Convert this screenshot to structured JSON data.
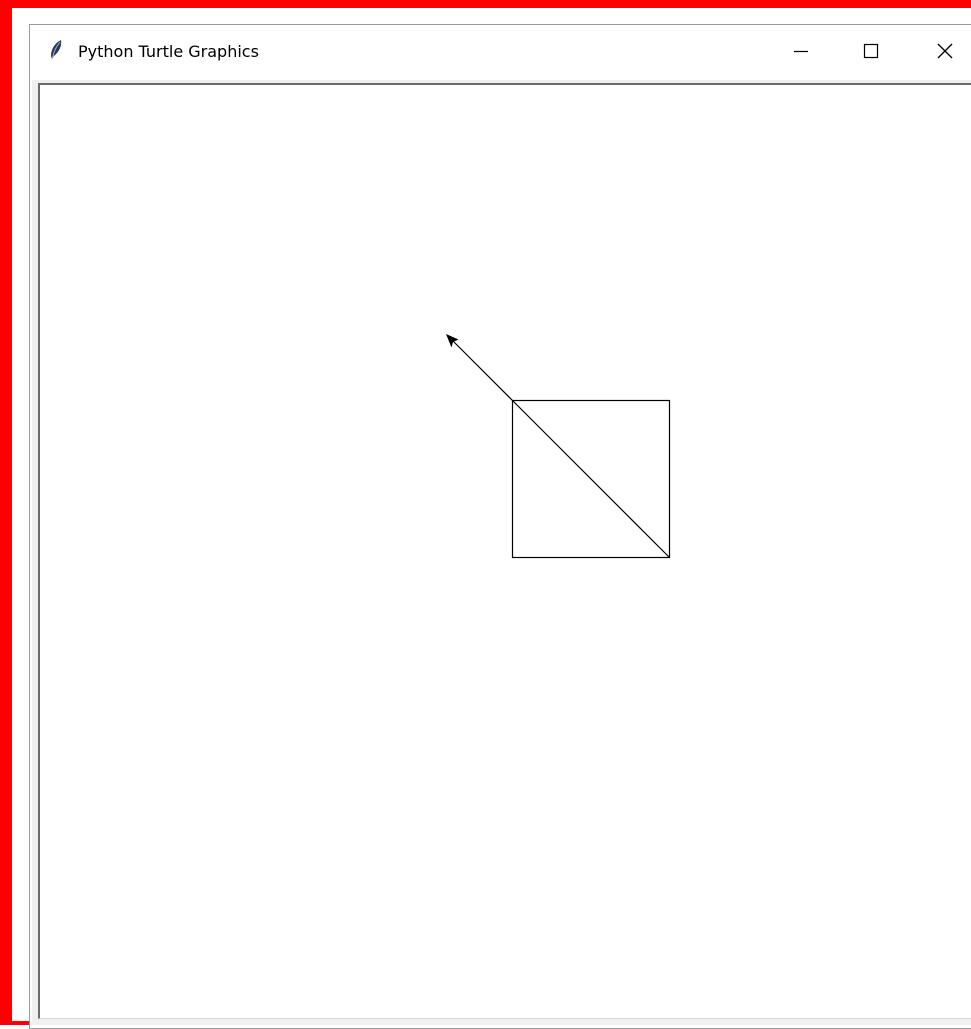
{
  "window": {
    "title": "Python Turtle Graphics",
    "icon": "feather-icon",
    "controls": {
      "minimize": "minimize-icon",
      "maximize": "maximize-icon",
      "close": "close-icon"
    }
  },
  "colors": {
    "highlight_border": "#ff0000",
    "canvas_background": "#ffffff",
    "pen": "#000000"
  },
  "turtle": {
    "shape": "classic",
    "heading_degrees": 135
  }
}
